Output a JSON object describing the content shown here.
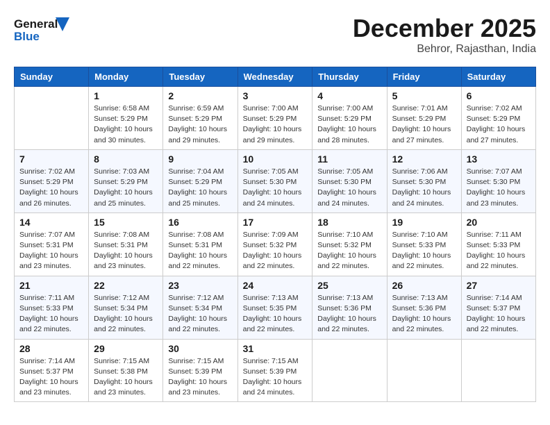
{
  "logo": {
    "line1": "General",
    "line2": "Blue"
  },
  "title": {
    "month": "December 2025",
    "location": "Behror, Rajasthan, India"
  },
  "weekdays": [
    "Sunday",
    "Monday",
    "Tuesday",
    "Wednesday",
    "Thursday",
    "Friday",
    "Saturday"
  ],
  "weeks": [
    [
      {
        "day": "",
        "info": ""
      },
      {
        "day": "1",
        "info": "Sunrise: 6:58 AM\nSunset: 5:29 PM\nDaylight: 10 hours\nand 30 minutes."
      },
      {
        "day": "2",
        "info": "Sunrise: 6:59 AM\nSunset: 5:29 PM\nDaylight: 10 hours\nand 29 minutes."
      },
      {
        "day": "3",
        "info": "Sunrise: 7:00 AM\nSunset: 5:29 PM\nDaylight: 10 hours\nand 29 minutes."
      },
      {
        "day": "4",
        "info": "Sunrise: 7:00 AM\nSunset: 5:29 PM\nDaylight: 10 hours\nand 28 minutes."
      },
      {
        "day": "5",
        "info": "Sunrise: 7:01 AM\nSunset: 5:29 PM\nDaylight: 10 hours\nand 27 minutes."
      },
      {
        "day": "6",
        "info": "Sunrise: 7:02 AM\nSunset: 5:29 PM\nDaylight: 10 hours\nand 27 minutes."
      }
    ],
    [
      {
        "day": "7",
        "info": "Sunrise: 7:02 AM\nSunset: 5:29 PM\nDaylight: 10 hours\nand 26 minutes."
      },
      {
        "day": "8",
        "info": "Sunrise: 7:03 AM\nSunset: 5:29 PM\nDaylight: 10 hours\nand 25 minutes."
      },
      {
        "day": "9",
        "info": "Sunrise: 7:04 AM\nSunset: 5:29 PM\nDaylight: 10 hours\nand 25 minutes."
      },
      {
        "day": "10",
        "info": "Sunrise: 7:05 AM\nSunset: 5:30 PM\nDaylight: 10 hours\nand 24 minutes."
      },
      {
        "day": "11",
        "info": "Sunrise: 7:05 AM\nSunset: 5:30 PM\nDaylight: 10 hours\nand 24 minutes."
      },
      {
        "day": "12",
        "info": "Sunrise: 7:06 AM\nSunset: 5:30 PM\nDaylight: 10 hours\nand 24 minutes."
      },
      {
        "day": "13",
        "info": "Sunrise: 7:07 AM\nSunset: 5:30 PM\nDaylight: 10 hours\nand 23 minutes."
      }
    ],
    [
      {
        "day": "14",
        "info": "Sunrise: 7:07 AM\nSunset: 5:31 PM\nDaylight: 10 hours\nand 23 minutes."
      },
      {
        "day": "15",
        "info": "Sunrise: 7:08 AM\nSunset: 5:31 PM\nDaylight: 10 hours\nand 23 minutes."
      },
      {
        "day": "16",
        "info": "Sunrise: 7:08 AM\nSunset: 5:31 PM\nDaylight: 10 hours\nand 22 minutes."
      },
      {
        "day": "17",
        "info": "Sunrise: 7:09 AM\nSunset: 5:32 PM\nDaylight: 10 hours\nand 22 minutes."
      },
      {
        "day": "18",
        "info": "Sunrise: 7:10 AM\nSunset: 5:32 PM\nDaylight: 10 hours\nand 22 minutes."
      },
      {
        "day": "19",
        "info": "Sunrise: 7:10 AM\nSunset: 5:33 PM\nDaylight: 10 hours\nand 22 minutes."
      },
      {
        "day": "20",
        "info": "Sunrise: 7:11 AM\nSunset: 5:33 PM\nDaylight: 10 hours\nand 22 minutes."
      }
    ],
    [
      {
        "day": "21",
        "info": "Sunrise: 7:11 AM\nSunset: 5:33 PM\nDaylight: 10 hours\nand 22 minutes."
      },
      {
        "day": "22",
        "info": "Sunrise: 7:12 AM\nSunset: 5:34 PM\nDaylight: 10 hours\nand 22 minutes."
      },
      {
        "day": "23",
        "info": "Sunrise: 7:12 AM\nSunset: 5:34 PM\nDaylight: 10 hours\nand 22 minutes."
      },
      {
        "day": "24",
        "info": "Sunrise: 7:13 AM\nSunset: 5:35 PM\nDaylight: 10 hours\nand 22 minutes."
      },
      {
        "day": "25",
        "info": "Sunrise: 7:13 AM\nSunset: 5:36 PM\nDaylight: 10 hours\nand 22 minutes."
      },
      {
        "day": "26",
        "info": "Sunrise: 7:13 AM\nSunset: 5:36 PM\nDaylight: 10 hours\nand 22 minutes."
      },
      {
        "day": "27",
        "info": "Sunrise: 7:14 AM\nSunset: 5:37 PM\nDaylight: 10 hours\nand 22 minutes."
      }
    ],
    [
      {
        "day": "28",
        "info": "Sunrise: 7:14 AM\nSunset: 5:37 PM\nDaylight: 10 hours\nand 23 minutes."
      },
      {
        "day": "29",
        "info": "Sunrise: 7:15 AM\nSunset: 5:38 PM\nDaylight: 10 hours\nand 23 minutes."
      },
      {
        "day": "30",
        "info": "Sunrise: 7:15 AM\nSunset: 5:39 PM\nDaylight: 10 hours\nand 23 minutes."
      },
      {
        "day": "31",
        "info": "Sunrise: 7:15 AM\nSunset: 5:39 PM\nDaylight: 10 hours\nand 24 minutes."
      },
      {
        "day": "",
        "info": ""
      },
      {
        "day": "",
        "info": ""
      },
      {
        "day": "",
        "info": ""
      }
    ]
  ]
}
